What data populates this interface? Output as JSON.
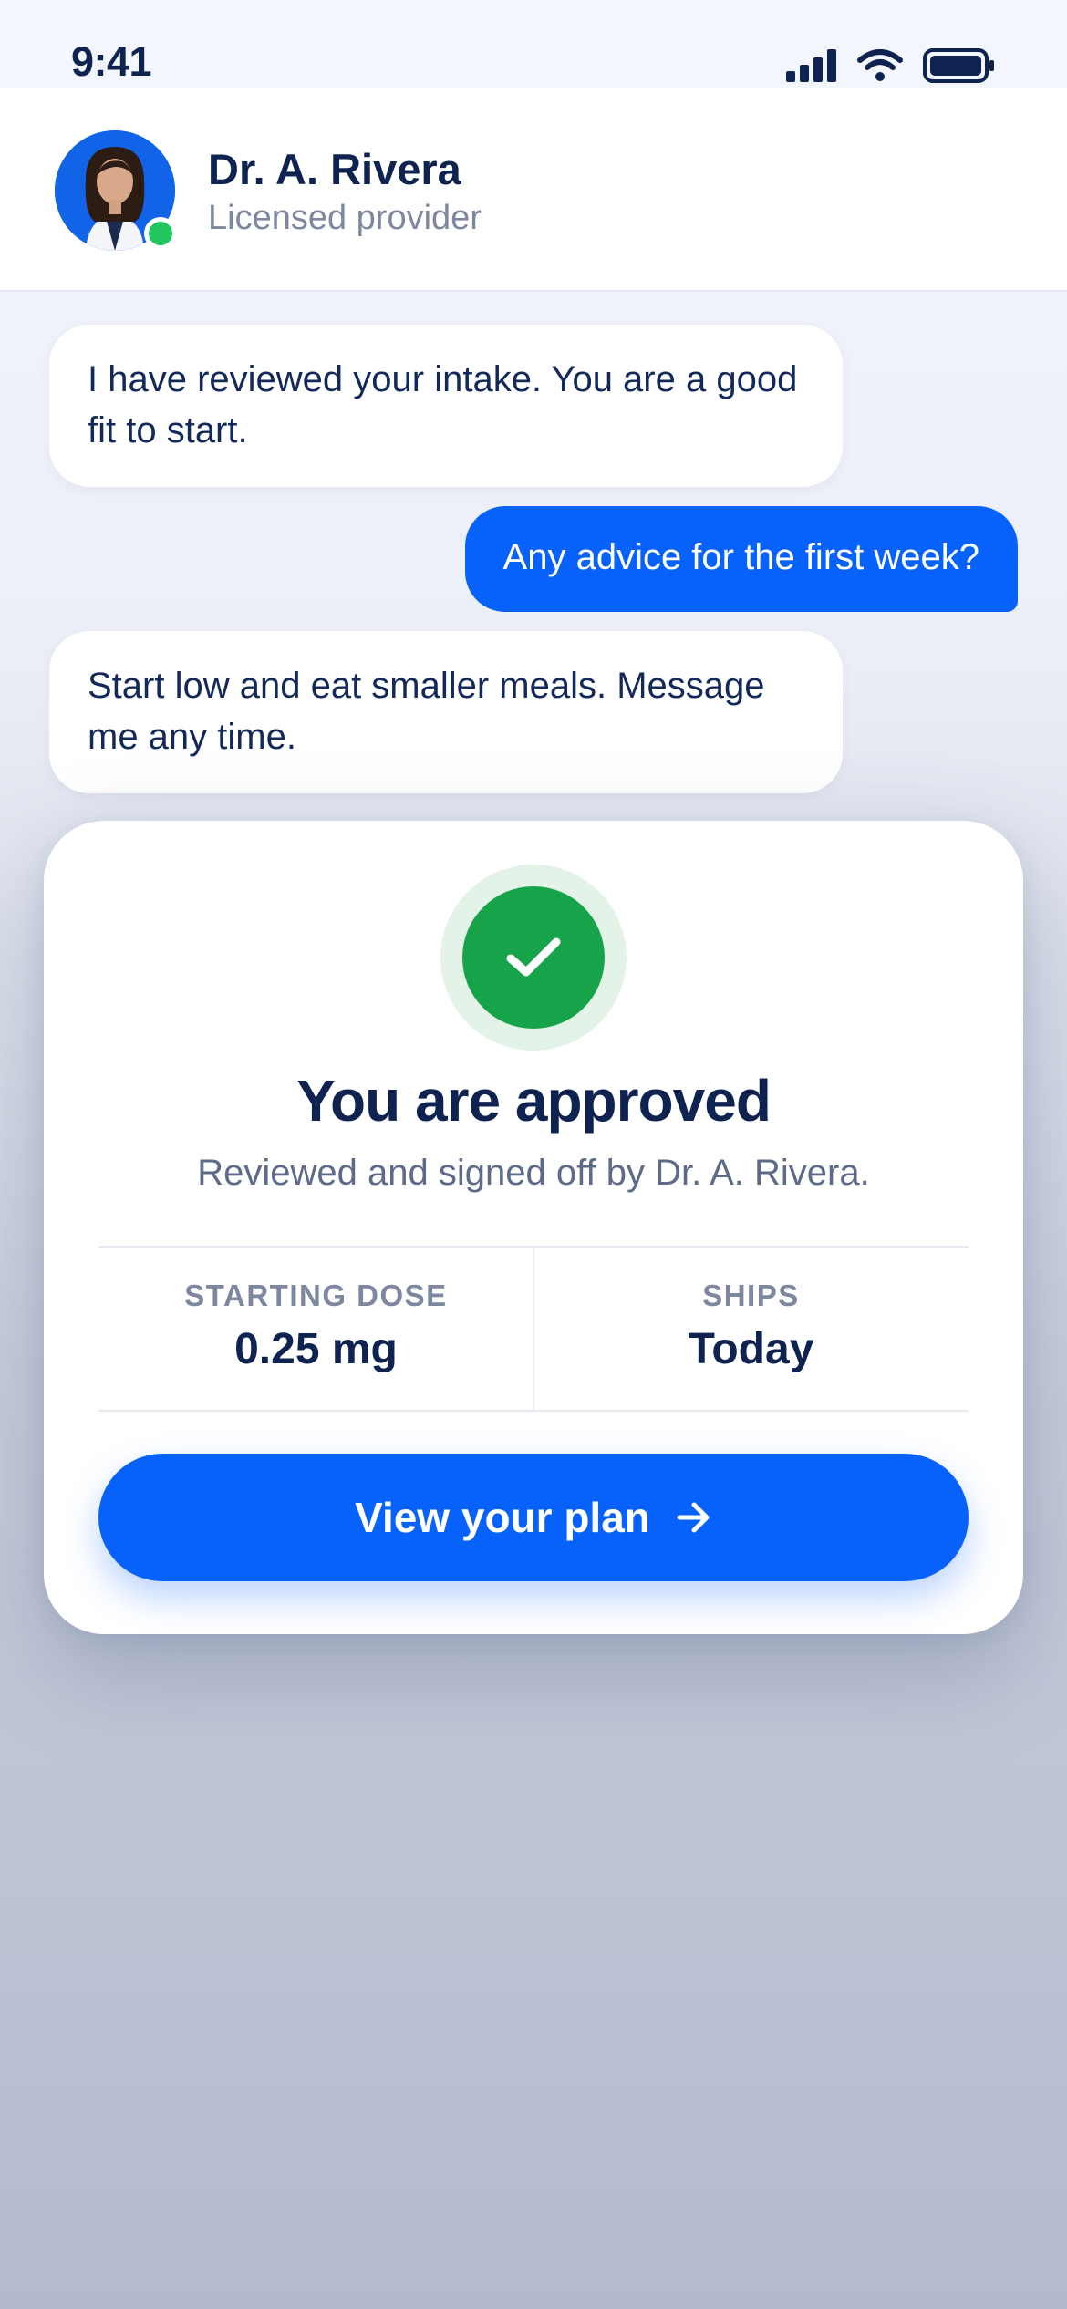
{
  "status_bar": {
    "time": "9:41",
    "icons": [
      "cellular-signal-icon",
      "wifi-icon",
      "battery-icon"
    ]
  },
  "header": {
    "avatar": "provider-photo",
    "online": true,
    "name": "Dr. A. Rivera",
    "role": "Licensed provider"
  },
  "chat": {
    "messages": [
      {
        "from": "provider",
        "text": "I have reviewed your intake. You are a good fit to start."
      },
      {
        "from": "user",
        "text": "Any advice for the first week?"
      },
      {
        "from": "provider",
        "text": "Start low and eat smaller meals. Message me any time."
      }
    ]
  },
  "approval": {
    "icon": "check-icon",
    "title": "You are approved",
    "subtitle": "Reviewed and signed off by Dr. A. Rivera.",
    "stats": [
      {
        "label": "STARTING DOSE",
        "value": "0.25 mg"
      },
      {
        "label": "SHIPS",
        "value": "Today"
      }
    ],
    "cta_label": "View your plan",
    "cta_icon": "arrow-right-icon"
  },
  "colors": {
    "primary": "#0762fb",
    "success": "#16a34a",
    "online": "#22c55e",
    "text": "#0f2350",
    "muted": "#7d87a0"
  }
}
